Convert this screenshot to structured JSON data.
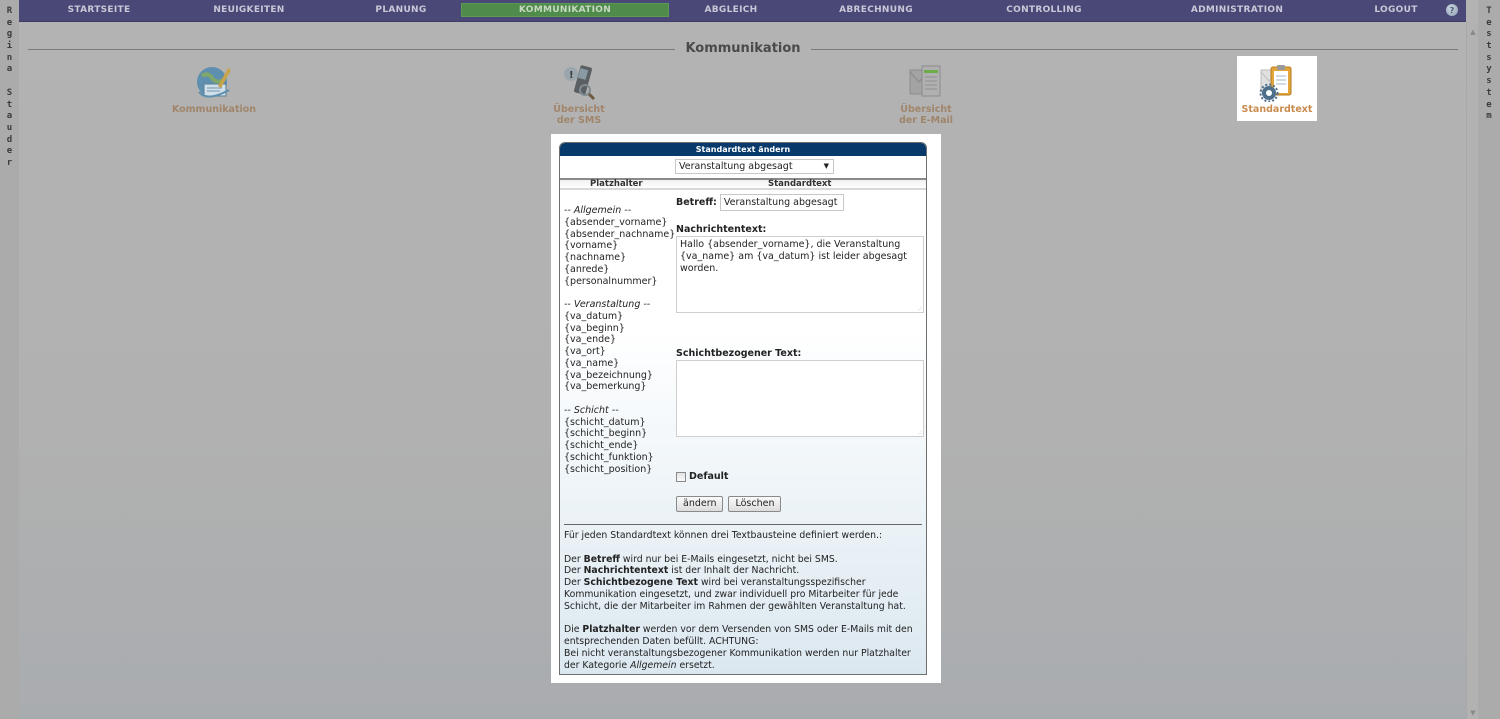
{
  "left_sidebar": {
    "text": "Regina Stauder"
  },
  "right_sidebar": {
    "text": "Testsystem"
  },
  "nav": {
    "items": [
      {
        "label": "STARTSEITE",
        "active": false
      },
      {
        "label": "NEUIGKEITEN",
        "active": false
      },
      {
        "label": "PLANUNG",
        "active": false
      },
      {
        "label": "KOMMUNIKATION",
        "active": true
      },
      {
        "label": "ABGLEICH",
        "active": false
      },
      {
        "label": "ABRECHNUNG",
        "active": false
      },
      {
        "label": "CONTROLLING",
        "active": false
      },
      {
        "label": "ADMINISTRATION",
        "active": false
      },
      {
        "label": "LOGOUT",
        "active": false
      }
    ],
    "help_icon": "help-icon",
    "colors": {
      "bar": "#4a4876",
      "active": "#4f8b4a"
    }
  },
  "section": {
    "title": "Kommunikation"
  },
  "tiles": [
    {
      "label": "Kommunikation",
      "icon": "globe-pencil-icon",
      "selected": false
    },
    {
      "label": "Übersicht\nder SMS",
      "icon": "phone-magnifier-icon",
      "selected": false
    },
    {
      "label": "Übersicht\nder E-Mail",
      "icon": "email-list-icon",
      "selected": false
    },
    {
      "label": "Standardtext",
      "icon": "clipboard-gear-icon",
      "selected": true
    }
  ],
  "dialog": {
    "title": "Standardtext ändern",
    "template_select": {
      "value": "Veranstaltung abgesagt"
    },
    "col_placeholders": "Platzhalter",
    "col_standardtext": "Standardtext",
    "placeholder_groups": [
      {
        "title": "-- Allgemein --",
        "items": [
          "{absender_vorname}",
          "{absender_nachname}",
          "{vorname}",
          "{nachname}",
          "{anrede}",
          "{personalnummer}"
        ]
      },
      {
        "title": "-- Veranstaltung --",
        "items": [
          "{va_datum}",
          "{va_beginn}",
          "{va_ende}",
          "{va_ort}",
          "{va_name}",
          "{va_bezeichnung}",
          "{va_bemerkung}"
        ]
      },
      {
        "title": "-- Schicht --",
        "items": [
          "{schicht_datum}",
          "{schicht_beginn}",
          "{schicht_ende}",
          "{schicht_funktion}",
          "{schicht_position}"
        ]
      }
    ],
    "betreff_label": "Betreff:",
    "betreff_value": "Veranstaltung abgesagt",
    "nachricht_label": "Nachrichtentext:",
    "nachricht_value": "Hallo {absender_vorname}, die Veranstaltung {va_name} am {va_datum} ist leider abgesagt worden.",
    "schicht_label": "Schichtbezogener Text:",
    "schicht_value": "",
    "default_label": "Default",
    "default_checked": false,
    "btn_aendern": "ändern",
    "btn_loeschen": "Löschen",
    "info": {
      "intro": "Für jeden Standardtext können drei Textbausteine definiert werden.:",
      "l1_pre": "Der ",
      "l1_bold": "Betreff",
      "l1_post": " wird nur bei E-Mails eingesetzt, nicht bei SMS.",
      "l2_pre": "Der ",
      "l2_bold": "Nachrichtentext",
      "l2_post": " ist der Inhalt der Nachricht.",
      "l3_pre": "Der ",
      "l3_bold": "Schichtbezogene Text",
      "l3_post": " wird bei veranstaltungsspezifischer Kommunikation eingesetzt, und zwar individuell pro Mitarbeiter für jede Schicht, die der Mitarbeiter im Rahmen der gewählten Veranstaltung hat.",
      "p3_pre": "Die ",
      "p3_bold": "Platzhalter",
      "p3_post": " werden vor dem Versenden von SMS oder E-Mails mit den entsprechenden Daten befüllt. ACHTUNG:",
      "p3_l2_pre": "Bei nicht veranstaltungsbezogener Kommunikation werden nur Platzhalter der Kategorie ",
      "p3_l2_italic": "Allgemein",
      "p3_l2_post": " ersetzt."
    }
  }
}
